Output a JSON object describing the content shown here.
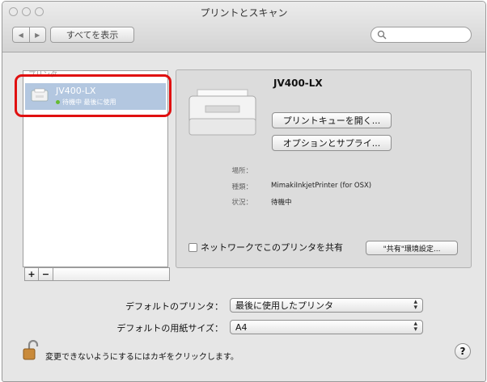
{
  "window": {
    "title": "プリントとスキャン"
  },
  "toolbar": {
    "back_glyph": "◀",
    "forward_glyph": "▶",
    "show_all_label": "すべてを表示",
    "search_placeholder": ""
  },
  "printer_list": {
    "header": "プリンタ",
    "items": [
      {
        "name": "JV400-LX",
        "status": "待機中 最後に使用",
        "status_color": "#66bb33"
      }
    ],
    "add_label": "+",
    "remove_label": "−"
  },
  "detail": {
    "printer_name": "JV400-LX",
    "open_queue_label": "プリントキューを開く...",
    "options_label": "オプションとサプライ...",
    "location_label": "場所：",
    "location_value": "",
    "kind_label": "種類：",
    "kind_value": "MimakiInkjetPrinter (for OSX)",
    "status_label": "状況：",
    "status_value": "待機中",
    "share_label": "ネットワークでこのプリンタを共有",
    "share_settings_label": "\"共有\"環境設定..."
  },
  "defaults": {
    "printer_label": "デフォルトのプリンタ：",
    "printer_value": "最後に使用したプリンタ",
    "paper_label": "デフォルトの用紙サイズ：",
    "paper_value": "A4"
  },
  "footer": {
    "lock_text": "変更できないようにするにはカギをクリックします。",
    "help_label": "?"
  },
  "colors": {
    "selection": "#b3c7e0",
    "highlight": "#e01010"
  }
}
